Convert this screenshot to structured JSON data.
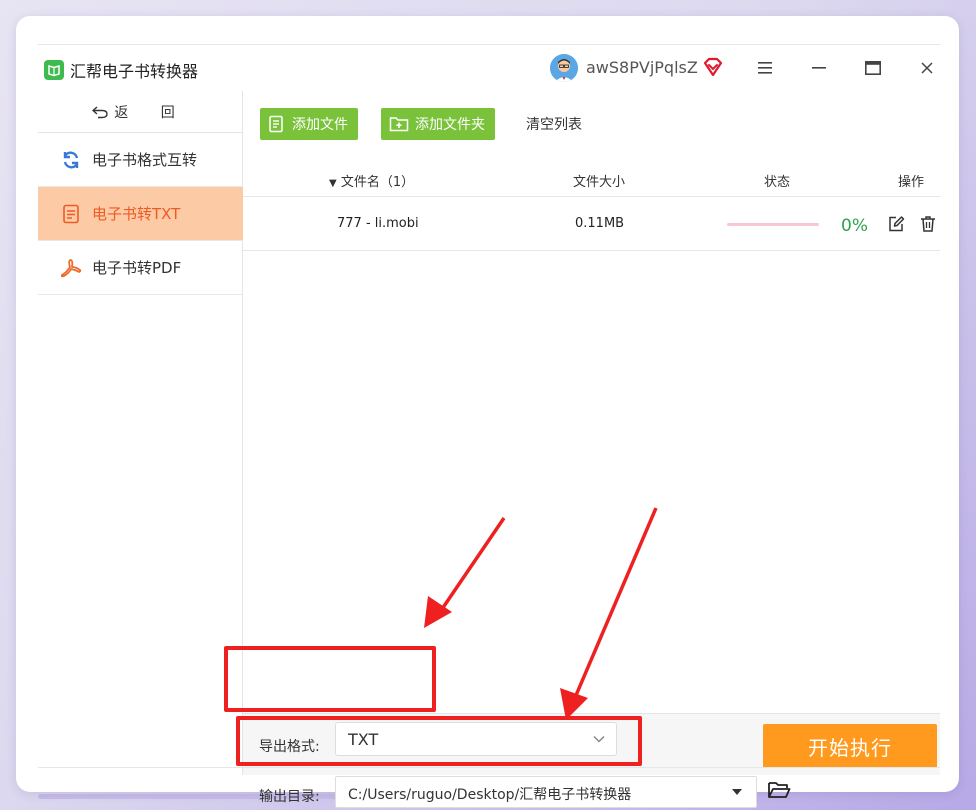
{
  "app": {
    "title": "汇帮电子书转换器",
    "username": "awS8PVjPqlsZ",
    "brand_color": "#3fba4f"
  },
  "window_controls": {
    "menu_icon": "hamburger-icon",
    "minimize_icon": "minimize-icon",
    "maximize_icon": "maximize-icon",
    "close_icon": "close-icon"
  },
  "sidebar": {
    "back_label": "返 回",
    "items": [
      {
        "label": "电子书格式互转",
        "icon": "refresh-icon",
        "active": false
      },
      {
        "label": "电子书转TXT",
        "icon": "document-icon",
        "active": true
      },
      {
        "label": "电子书转PDF",
        "icon": "pdf-icon",
        "active": false
      }
    ]
  },
  "toolbar": {
    "add_file_label": "添加文件",
    "add_folder_label": "添加文件夹",
    "clear_list_label": "清空列表"
  },
  "table": {
    "columns": {
      "name": "文件名（1）",
      "size": "文件大小",
      "status": "状态",
      "actions": "操作"
    },
    "rows": [
      {
        "name": "777 - li.mobi",
        "size": "0.11MB",
        "progress": 0,
        "progress_text": "0%"
      }
    ]
  },
  "settings": {
    "format_label": "导出格式:",
    "format_value": "TXT",
    "output_label": "输出目录:",
    "output_value": "C:/Users/ruguo/Desktop/汇帮电子书转换器",
    "start_label": "开始执行"
  },
  "colors": {
    "accent_green": "#7bc23b",
    "active_bg": "#fdcaa6",
    "active_text": "#ee5a24",
    "start_button": "#ff9a1f",
    "annotation_red": "#ee2020",
    "progress_pct": "#30a14e"
  }
}
